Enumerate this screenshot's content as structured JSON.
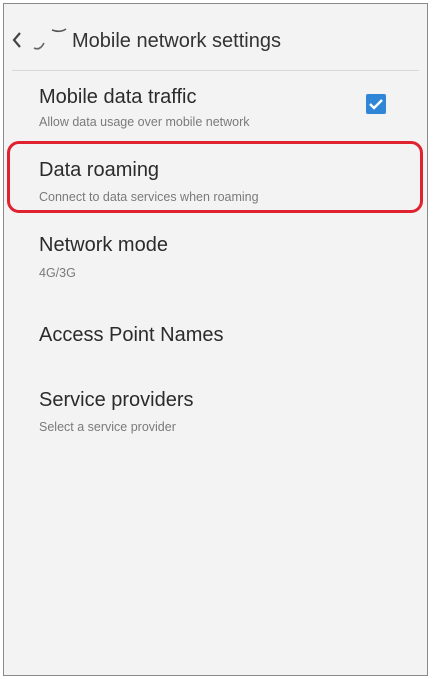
{
  "header": {
    "title": "Mobile network settings"
  },
  "settings": [
    {
      "title": "Mobile data traffic",
      "summary": "Allow data usage over mobile network",
      "checked": true
    },
    {
      "title": "Data roaming",
      "summary": "Connect to data services when roaming",
      "highlighted": true
    },
    {
      "title": "Network mode",
      "summary": "4G/3G"
    },
    {
      "title": "Access Point Names",
      "summary": ""
    },
    {
      "title": "Service providers",
      "summary": "Select a service provider"
    }
  ],
  "colors": {
    "accent": "#2f86d6",
    "highlight": "#e0212f"
  },
  "icons": {
    "back": "chevron-left-icon",
    "check": "check-icon"
  }
}
